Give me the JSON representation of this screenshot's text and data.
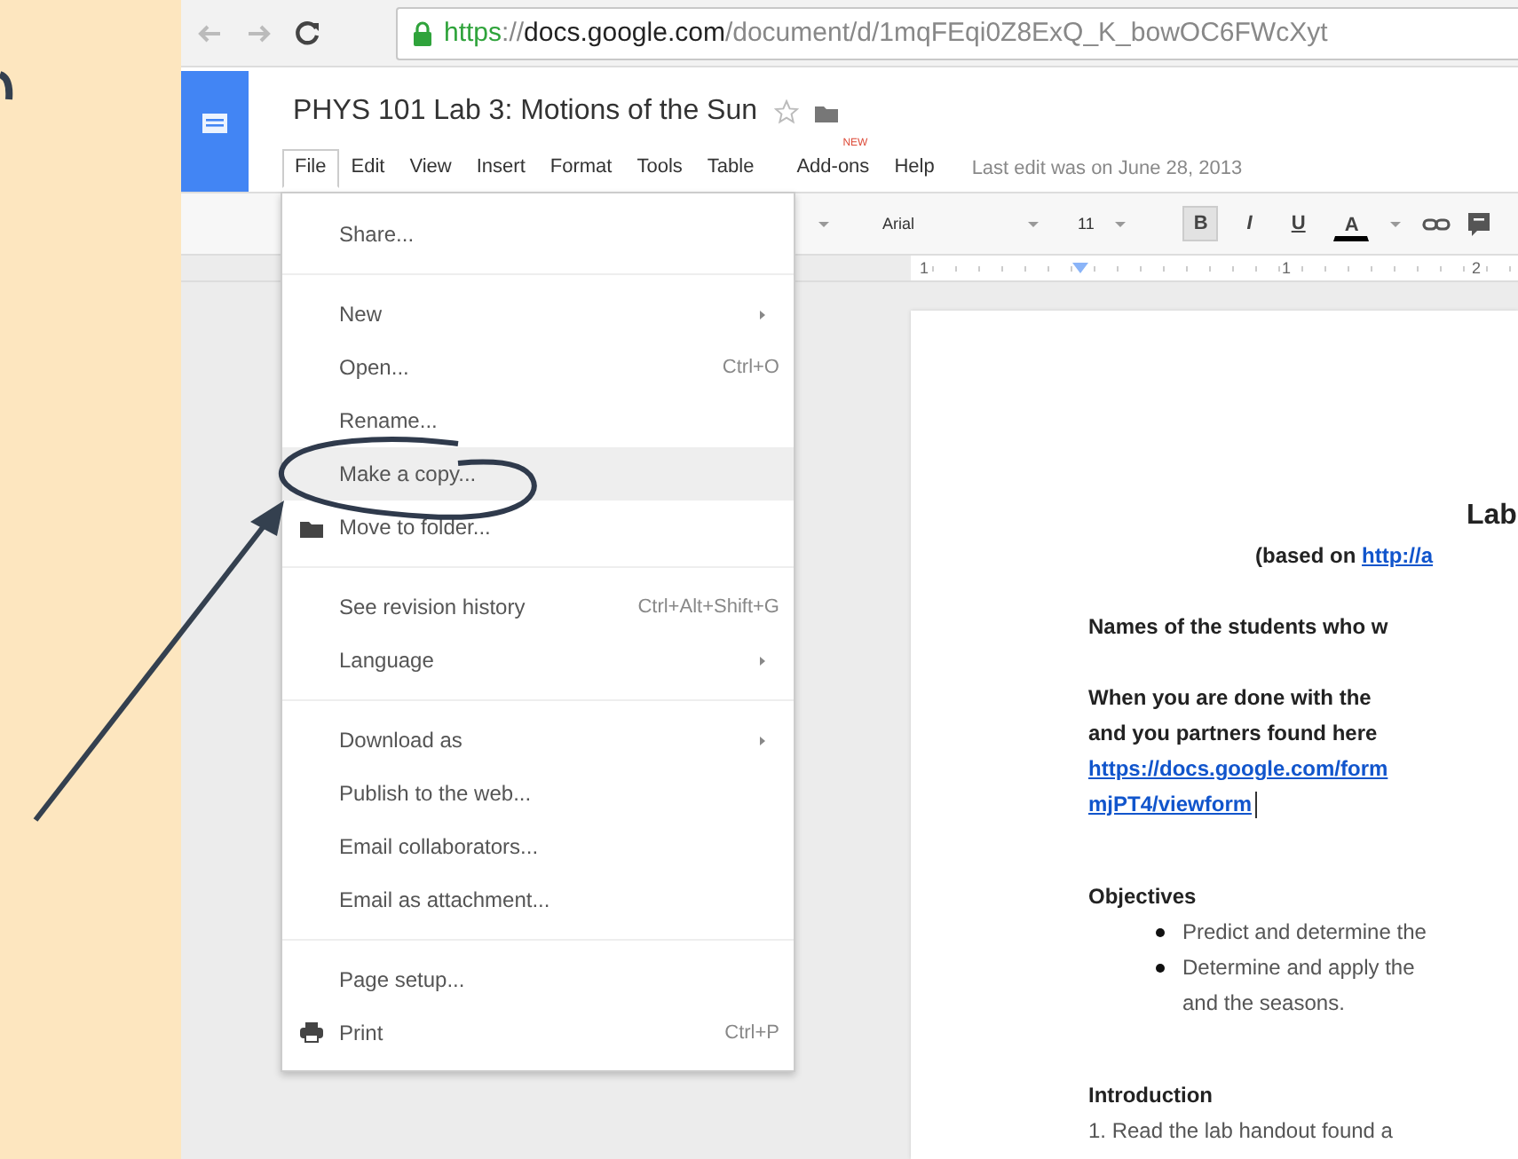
{
  "browser": {
    "url": {
      "scheme": "https",
      "separator": "://",
      "host": "docs.google.com",
      "path": "/document/d/1mqFEqi0Z8ExQ_K_bowOC6FWcXyt"
    }
  },
  "document": {
    "title": "PHYS 101 Lab 3: Motions of the Sun",
    "starred": false
  },
  "menu_bar": [
    {
      "label": "File",
      "selected": true
    },
    {
      "label": "Edit",
      "selected": false
    },
    {
      "label": "View",
      "selected": false
    },
    {
      "label": "Insert",
      "selected": false
    },
    {
      "label": "Format",
      "selected": false
    },
    {
      "label": "Tools",
      "selected": false
    },
    {
      "label": "Table",
      "selected": false
    },
    {
      "label": "Add-ons",
      "selected": false,
      "badge": "NEW"
    },
    {
      "label": "Help",
      "selected": false
    }
  ],
  "last_edit": "Last edit was on June 28, 2013",
  "toolbar": {
    "font": "Arial",
    "size": "11",
    "bold": true,
    "bold_label": "B",
    "italic_label": "I",
    "underline_label": "U",
    "color_label": "A"
  },
  "ruler": [
    "1",
    "1",
    "2"
  ],
  "file_menu": [
    {
      "kind": "item",
      "label": "Share...",
      "selected": false
    },
    {
      "kind": "separator"
    },
    {
      "kind": "item",
      "label": "New",
      "submenu": true,
      "selected": false
    },
    {
      "kind": "item",
      "label": "Open...",
      "shortcut": "Ctrl+O",
      "selected": false
    },
    {
      "kind": "item",
      "label": "Rename...",
      "selected": false
    },
    {
      "kind": "item",
      "label": "Make a copy...",
      "selected": true
    },
    {
      "kind": "folder_item",
      "label": "Move to folder...",
      "selected": false
    },
    {
      "kind": "separator"
    },
    {
      "kind": "item",
      "label": "See revision history",
      "shortcut": "Ctrl+Alt+Shift+G",
      "selected": false
    },
    {
      "kind": "item",
      "label": "Language",
      "submenu": true,
      "selected": false
    },
    {
      "kind": "separator"
    },
    {
      "kind": "item",
      "label": "Download as",
      "submenu": true,
      "selected": false
    },
    {
      "kind": "item",
      "label": "Publish to the web...",
      "selected": false
    },
    {
      "kind": "item",
      "label": "Email collaborators...",
      "selected": false
    },
    {
      "kind": "item",
      "label": "Email as attachment...",
      "selected": false
    },
    {
      "kind": "separator"
    },
    {
      "kind": "item",
      "label": "Page setup...",
      "selected": false
    },
    {
      "kind": "print_item",
      "label": "Print",
      "shortcut": "Ctrl+P",
      "selected": false
    }
  ],
  "page": [
    {
      "kind": "heading",
      "text": "Lab"
    },
    {
      "kind": "subtitle",
      "text": "(based on ",
      "link": "http://a"
    },
    {
      "kind": "bold",
      "text": "Names of the students who w",
      "gap": true
    },
    {
      "kind": "bold",
      "text": "When you are done with the",
      "gap": true
    },
    {
      "kind": "bold",
      "text": "and you partners found here"
    },
    {
      "kind": "link",
      "text": "https://docs.google.com/form"
    },
    {
      "kind": "link",
      "text": "mjPT4/viewform",
      "cursor": true
    },
    {
      "kind": "section",
      "text": "Objectives",
      "gap": true
    },
    {
      "kind": "bullet",
      "text": "Predict and determine the"
    },
    {
      "kind": "bullet",
      "text": "Determine and apply the"
    },
    {
      "kind": "continuation",
      "text": "and the seasons."
    },
    {
      "kind": "section",
      "text": "Introduction",
      "gap": true
    },
    {
      "kind": "body",
      "text": "1. Read the lab handout found a"
    }
  ]
}
